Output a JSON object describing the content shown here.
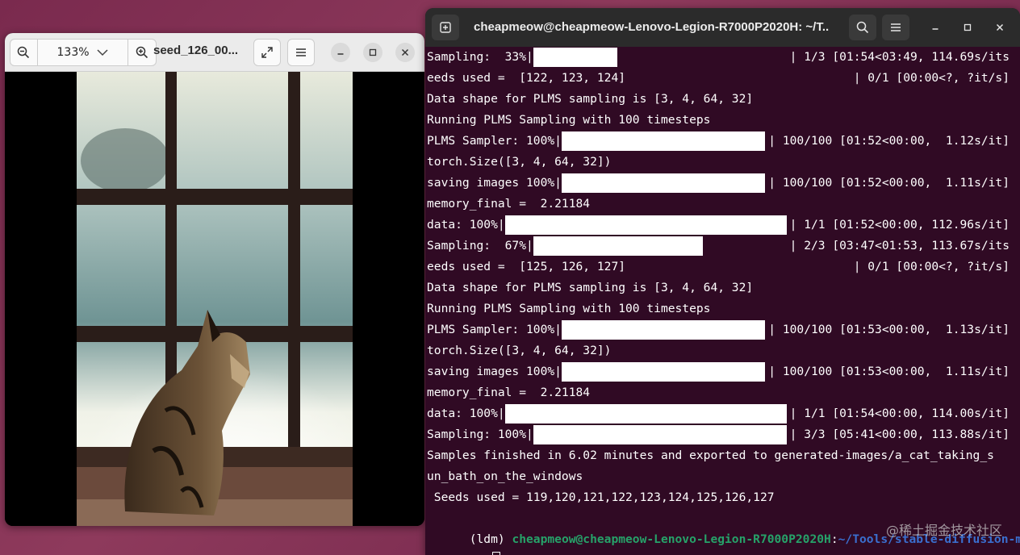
{
  "viewer": {
    "zoom_value": "133%",
    "title": "seed_126_00...",
    "icons": {
      "zoom_out": "zoom-out-icon",
      "zoom_dropdown": "chevron-down-icon",
      "zoom_in": "zoom-in-icon",
      "fullscreen": "fullscreen-icon",
      "menu": "hamburger-menu-icon",
      "minimize": "minimize-icon",
      "maximize": "maximize-icon",
      "close": "close-icon"
    },
    "image_subject": "kitten-by-window-photo"
  },
  "terminal": {
    "title": "cheapmeow@cheapmeow-Lenovo-Legion-R7000P2020H: ~/T...",
    "icons": {
      "new_tab": "new-tab-icon",
      "search": "search-icon",
      "menu": "hamburger-menu-icon",
      "minimize": "minimize-icon",
      "maximize": "maximize-icon",
      "close": "close-icon"
    },
    "lines": [
      {
        "text": "Sampling:  33%|",
        "bar": 0.33,
        "suffix": "| 1/3 [01:54<03:49, 114.69s/its"
      },
      {
        "text": "eeds used =  [122, 123, 124]",
        "suffix": "| 0/1 [00:00<?, ?it/s]"
      },
      {
        "text": "Data shape for PLMS sampling is [3, 4, 64, 32]"
      },
      {
        "text": "Running PLMS Sampling with 100 timesteps"
      },
      {
        "text": "PLMS Sampler: 100%|",
        "bar": 1.0,
        "suffix": "| 100/100 [01:52<00:00,  1.12s/it]"
      },
      {
        "text": "torch.Size([3, 4, 64, 32])"
      },
      {
        "text": "saving images 100%|",
        "bar": 1.0,
        "suffix": "| 100/100 [01:52<00:00,  1.11s/it]"
      },
      {
        "text": "memory_final =  2.21184"
      },
      {
        "text": "data: 100%|",
        "bar": 1.0,
        "suffix": "| 1/1 [01:52<00:00, 112.96s/it]"
      },
      {
        "text": "Sampling:  67%|",
        "bar": 0.67,
        "suffix": "| 2/3 [03:47<01:53, 113.67s/its"
      },
      {
        "text": "eeds used =  [125, 126, 127]",
        "suffix": "| 0/1 [00:00<?, ?it/s]"
      },
      {
        "text": "Data shape for PLMS sampling is [3, 4, 64, 32]"
      },
      {
        "text": "Running PLMS Sampling with 100 timesteps"
      },
      {
        "text": "PLMS Sampler: 100%|",
        "bar": 1.0,
        "suffix": "| 100/100 [01:53<00:00,  1.13s/it]"
      },
      {
        "text": "torch.Size([3, 4, 64, 32])"
      },
      {
        "text": "saving images 100%|",
        "bar": 1.0,
        "suffix": "| 100/100 [01:53<00:00,  1.11s/it]"
      },
      {
        "text": "memory_final =  2.21184"
      },
      {
        "text": "data: 100%|",
        "bar": 1.0,
        "suffix": "| 1/1 [01:54<00:00, 114.00s/it]"
      },
      {
        "text": "Sampling: 100%|",
        "bar": 1.0,
        "suffix": "| 3/3 [05:41<00:00, 113.88s/it]"
      },
      {
        "text": "Samples finished in 6.02 minutes and exported to generated-images/a_cat_taking_s"
      },
      {
        "text": "un_bath_on_the_windows"
      },
      {
        "text": " Seeds used = 119,120,121,122,123,124,125,126,127"
      }
    ],
    "prompt": {
      "env": "(ldm) ",
      "user_host": "cheapmeow@cheapmeow-Lenovo-Legion-R7000P2020H",
      "colon": ":",
      "path_part1": "~/Tools/stable-diffusion-mai",
      "path_part2": "n",
      "symbol": "$ "
    },
    "watermark": "@稀土掘金技术社区",
    "colors": {
      "background": "#300a24",
      "user_host": "#26a269",
      "path": "#3a6fcf"
    }
  }
}
